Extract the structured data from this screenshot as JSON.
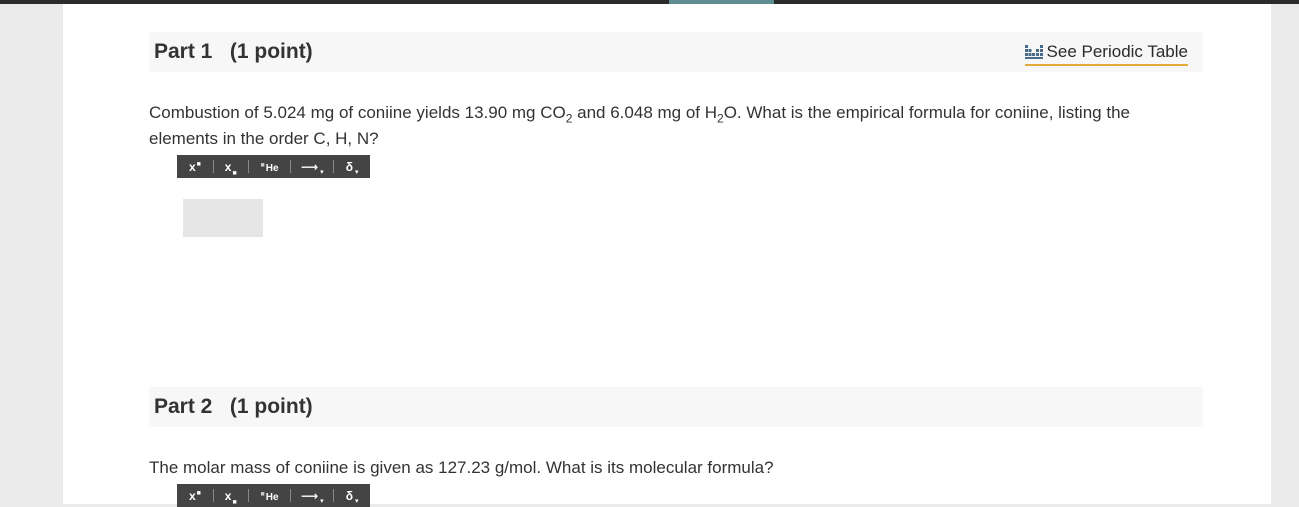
{
  "part1": {
    "title": "Part 1   (1 point)",
    "periodic_link": "See Periodic Table",
    "question": {
      "t1": "Combustion of 5.024 mg of coniine yields 13.90 mg CO",
      "s1": "2",
      "t2": " and 6.048 mg of H",
      "s2": "2",
      "t3": "O. What is the empirical formula for coniine, listing the elements in the order C, H, N?"
    },
    "answer_value": ""
  },
  "toolbar": {
    "superscript": "x",
    "subscript": "x",
    "element": "He",
    "arrow": "⟶",
    "delta": "δ"
  },
  "part2": {
    "title": "Part 2   (1 point)",
    "question": "The molar mass of coniine is given as 127.23 g/mol. What is its molecular formula?"
  },
  "icons": {
    "periodic": "periodic-table-icon",
    "superscript": "superscript-icon",
    "subscript": "subscript-icon",
    "element": "element-symbol-icon",
    "arrow": "reaction-arrow-icon",
    "delta": "delta-icon"
  }
}
